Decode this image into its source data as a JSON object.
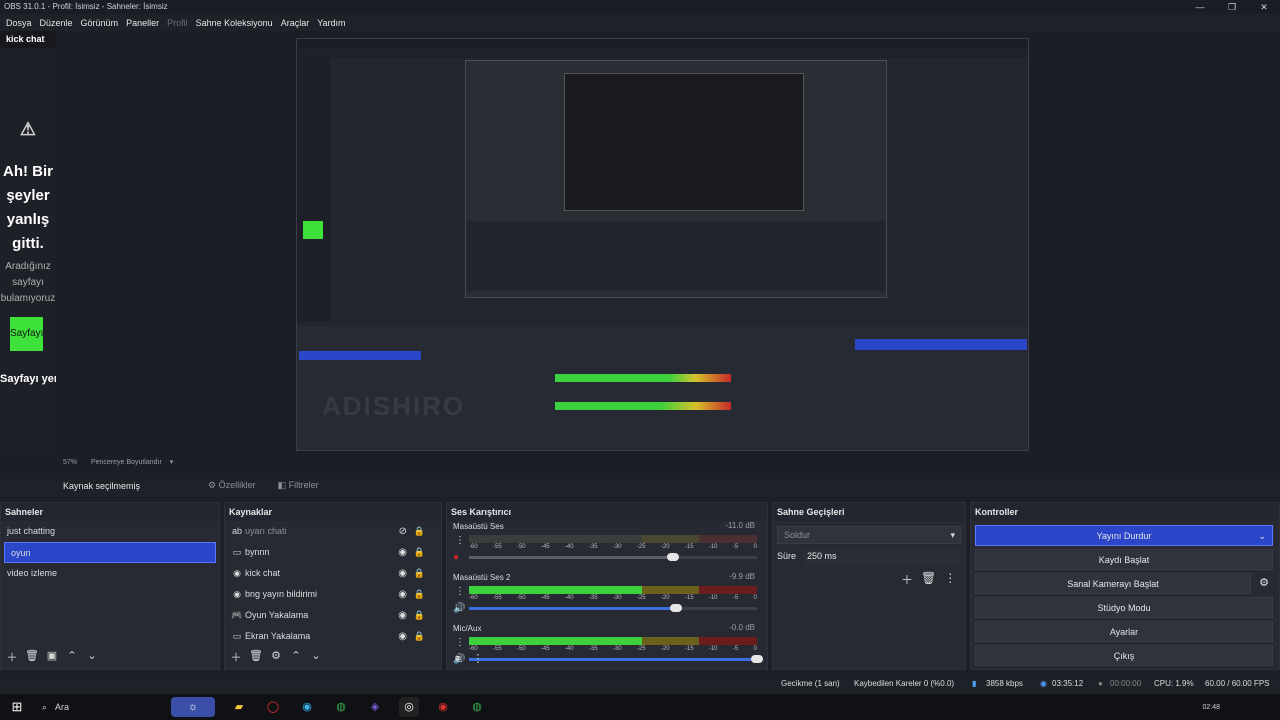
{
  "window": {
    "title": "OBS 31.0.1 - Profil: İsimsiz - Sahneler: İsimsiz",
    "minimize": "—",
    "maximize": "❐",
    "close": "✕"
  },
  "menu": [
    "Dosya",
    "Düzenle",
    "Görünüm",
    "Paneller",
    "Profil",
    "Sahne Koleksiyonu",
    "Araçlar",
    "Yardım"
  ],
  "browser": {
    "label": "kick chat",
    "error_title_lines": [
      "Ah! Bir",
      "şeyler",
      "yanlış",
      "gitti."
    ],
    "error_sub_lines": [
      "Aradığınız",
      "sayfayı",
      "bulamıyoruz"
    ],
    "button": "Sayfayı",
    "footer": "Sayfayı yen"
  },
  "nested": {
    "watermark": "ADISHIRO"
  },
  "zoom": {
    "percent": "57%",
    "mode": "Pencereye Boyutlandır"
  },
  "source_toolbar": {
    "status": "Kaynak seçilmemiş",
    "properties": "Özellikler",
    "filters": "Filtreler"
  },
  "scenes": {
    "title": "Sahneler",
    "items": [
      "just chatting",
      "oyun",
      "video izleme"
    ],
    "selected_index": 1
  },
  "sources": {
    "title": "Kaynaklar",
    "items": [
      {
        "name": "uyarı chati",
        "icon": "ab"
      },
      {
        "name": "bynnn",
        "icon": "▭"
      },
      {
        "name": "kick chat",
        "icon": "◉"
      },
      {
        "name": "bng yayın bildirimi",
        "icon": "◉"
      },
      {
        "name": "Oyun Yakalama",
        "icon": "🎮"
      },
      {
        "name": "Ekran Yakalama",
        "icon": "▭"
      }
    ]
  },
  "mixer": {
    "title": "Ses Karıştırıcı",
    "ticks": [
      "-60",
      "-55",
      "-50",
      "-45",
      "-40",
      "-35",
      "-30",
      "-25",
      "-20",
      "-15",
      "-10",
      "-5",
      "0"
    ],
    "channels": [
      {
        "name": "Masaüstü Ses",
        "db": "-11.0 dB",
        "level": 0.0,
        "volume": 0.71
      },
      {
        "name": "Masaüstü Ses 2",
        "db": "-9.9 dB",
        "level": 0.65,
        "volume": 0.72
      },
      {
        "name": "Mic/Aux",
        "db": "-0.0 dB",
        "level": 0.68,
        "volume": 1.0
      }
    ]
  },
  "transitions": {
    "title": "Sahne Geçişleri",
    "selected": "Soldur",
    "duration_label": "Süre",
    "duration_value": "250 ms"
  },
  "controls": {
    "title": "Kontroller",
    "buttons": [
      "Yayını Durdur",
      "Kaydı Başlat",
      "Sanal Kamerayı Başlat",
      "Stüdyo Modu",
      "Ayarlar",
      "Çıkış"
    ]
  },
  "status": {
    "delay": "Gecikme (1 san)",
    "dropped": "Kaybedilen Kareler 0 (%0.0)",
    "bitrate": "3858 kbps",
    "stream_time": "03:35:12",
    "rec_time": "00:00:00",
    "cpu": "CPU: 1.9%",
    "fps": "60.00 / 60.00 FPS"
  },
  "taskbar": {
    "search": "Ara",
    "time": "02:48"
  },
  "colors": {
    "accent": "#2b46c9",
    "meter_green": "#3ecf3e",
    "meter_yellow": "#d6c22a",
    "meter_red": "#c42a2a"
  }
}
